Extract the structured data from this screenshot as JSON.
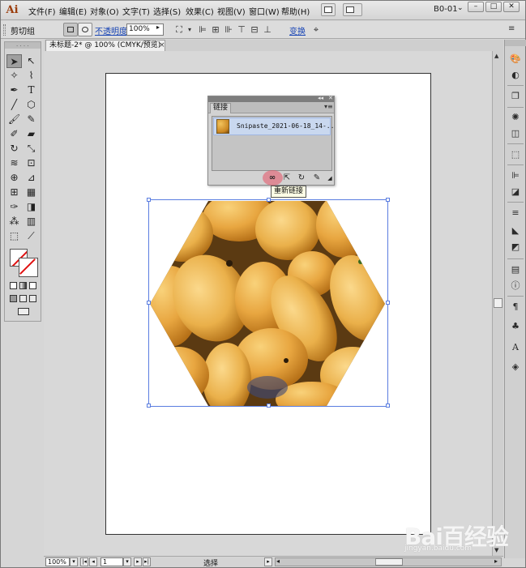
{
  "app": {
    "logo": "Ai"
  },
  "menu": {
    "items": [
      "文件(F)",
      "编辑(E)",
      "对象(O)",
      "文字(T)",
      "选择(S)",
      "效果(C)",
      "视图(V)",
      "窗口(W)",
      "帮助(H)"
    ],
    "workspace": "B0-01",
    "window_buttons": [
      "–",
      "□",
      "✕"
    ]
  },
  "control_bar": {
    "selection": "剪切组",
    "opacity_label": "不透明度:",
    "opacity_value": "100%",
    "transform_label": "变换"
  },
  "document": {
    "tab_title": "未标题-2* @ 100% (CMYK/预览)",
    "tab_close": "×"
  },
  "links_panel": {
    "tab": "链接",
    "file_name": "Snipaste_2021-06-18_14-..",
    "tooltip": "重新链接"
  },
  "status_bar": {
    "zoom": "100%",
    "page": "1",
    "status": "选择"
  },
  "watermark": {
    "logo": "Bai百经验",
    "url": "jingyan.baidu.com"
  },
  "colors": {
    "selection_blue": "#5a7de0",
    "link_highlight": "#c9d8ef",
    "relink_highlight": "#e65064"
  }
}
